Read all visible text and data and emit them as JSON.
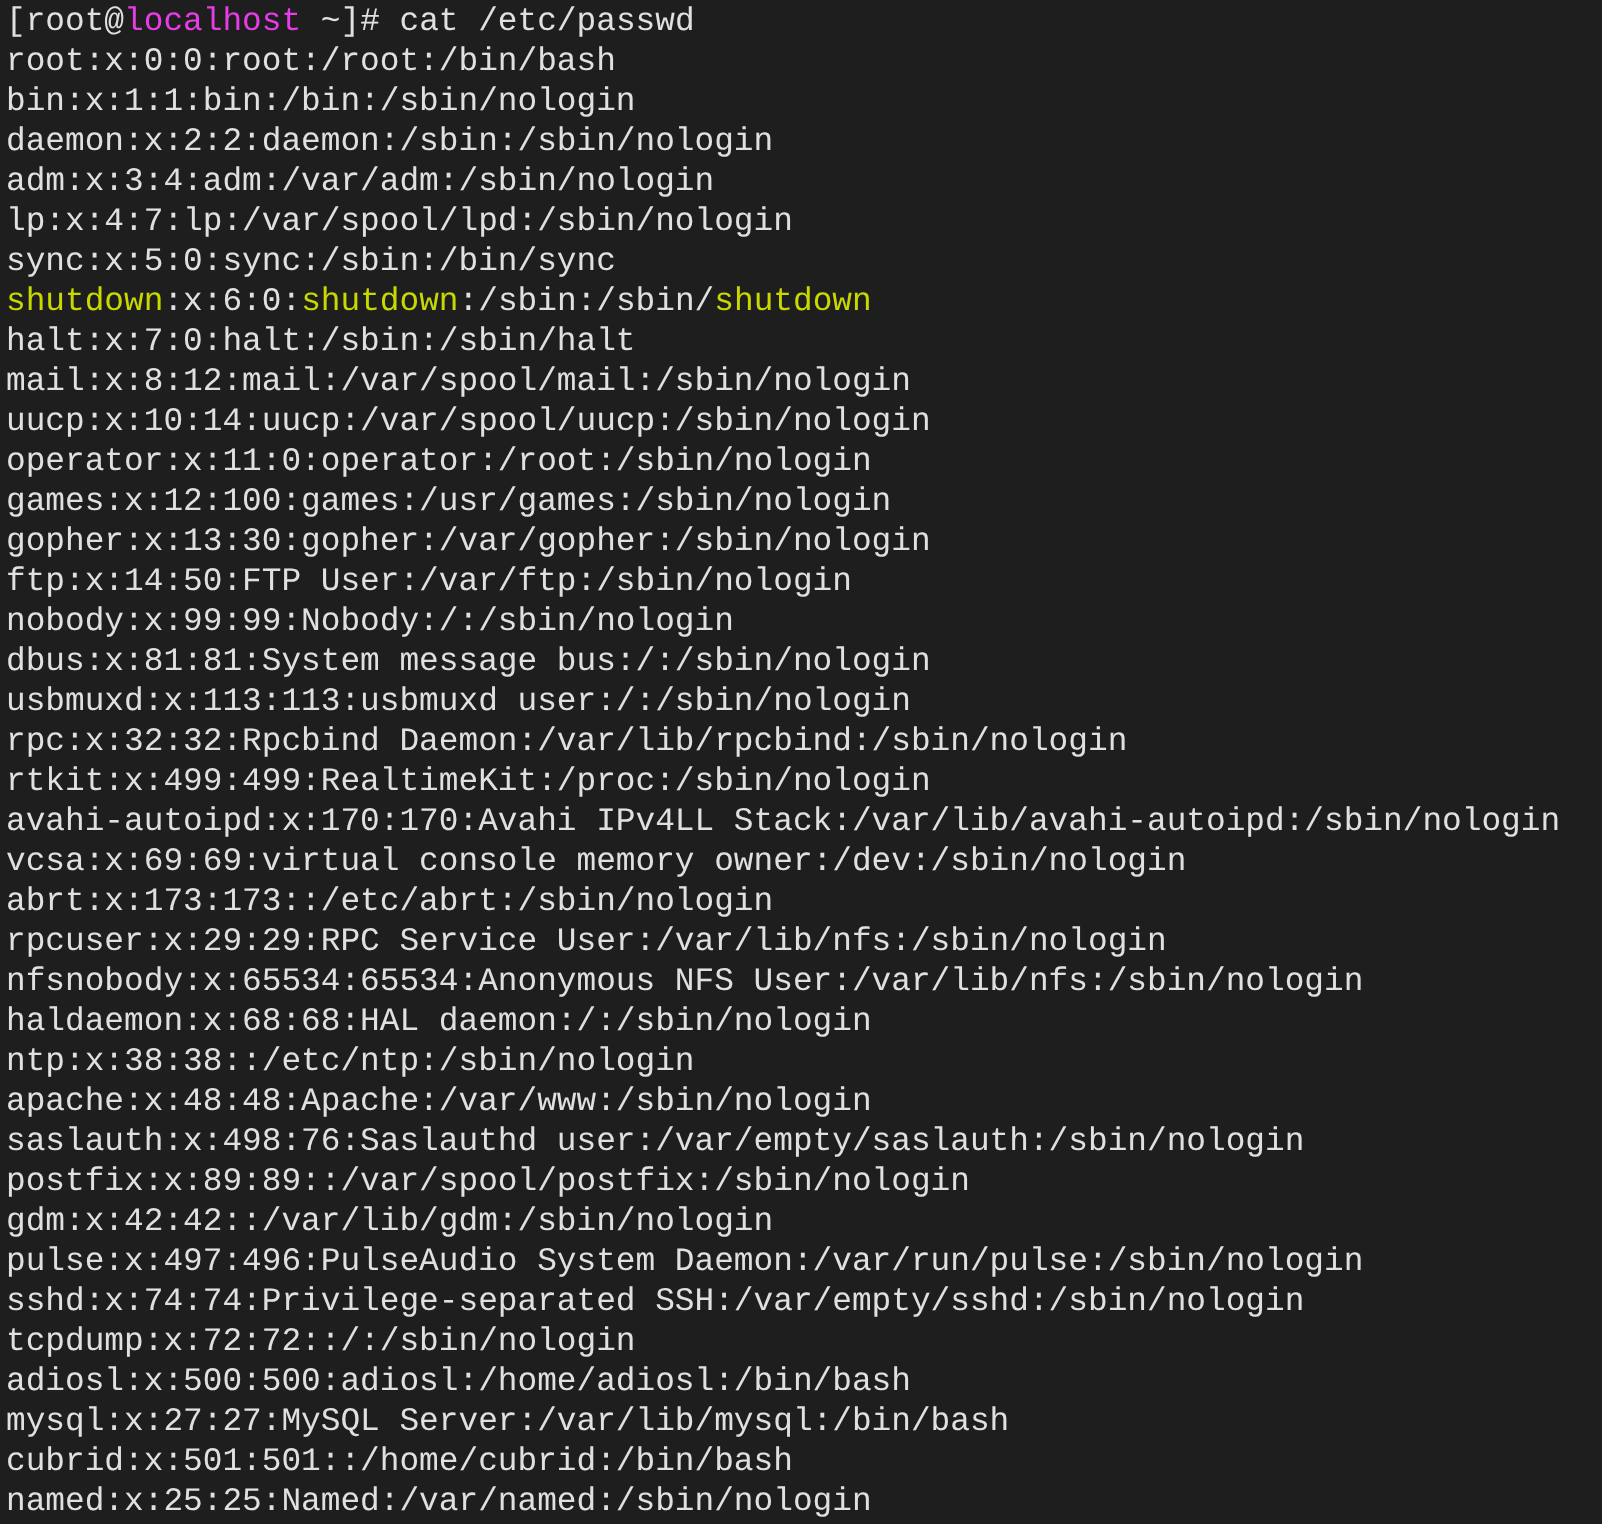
{
  "terminal": {
    "lines": [
      {
        "segments": [
          {
            "text": "[root@",
            "color": "#e0e0e0"
          },
          {
            "text": "localhost",
            "color": "#e83ce8"
          },
          {
            "text": " ~]# cat /etc/passwd",
            "color": "#e0e0e0"
          }
        ]
      },
      {
        "segments": [
          {
            "text": "root:x:0:0:root:/root:/bin/bash",
            "color": "#e0e0e0"
          }
        ]
      },
      {
        "segments": [
          {
            "text": "bin:x:1:1:bin:/bin:/sbin/nologin",
            "color": "#e0e0e0"
          }
        ]
      },
      {
        "segments": [
          {
            "text": "daemon:x:2:2:daemon:/sbin:/sbin/nologin",
            "color": "#e0e0e0"
          }
        ]
      },
      {
        "segments": [
          {
            "text": "adm:x:3:4:adm:/var/adm:/sbin/nologin",
            "color": "#e0e0e0"
          }
        ]
      },
      {
        "segments": [
          {
            "text": "lp:x:4:7:lp:/var/spool/lpd:/sbin/nologin",
            "color": "#e0e0e0"
          }
        ]
      },
      {
        "segments": [
          {
            "text": "sync:x:5:0:sync:/sbin:/bin/sync",
            "color": "#e0e0e0"
          }
        ]
      },
      {
        "segments": [
          {
            "text": "shutdown",
            "color": "#c8d800"
          },
          {
            "text": ":x:6:0:",
            "color": "#e0e0e0"
          },
          {
            "text": "shutdown",
            "color": "#c8d800"
          },
          {
            "text": ":/sbin:/sbin/",
            "color": "#e0e0e0"
          },
          {
            "text": "shutdown",
            "color": "#c8d800"
          }
        ]
      },
      {
        "segments": [
          {
            "text": "halt:x:7:0:halt:/sbin:/sbin/halt",
            "color": "#e0e0e0"
          }
        ]
      },
      {
        "segments": [
          {
            "text": "mail:x:8:12:mail:/var/spool/mail:/sbin/nologin",
            "color": "#e0e0e0"
          }
        ]
      },
      {
        "segments": [
          {
            "text": "uucp:x:10:14:uucp:/var/spool/uucp:/sbin/nologin",
            "color": "#e0e0e0"
          }
        ]
      },
      {
        "segments": [
          {
            "text": "operator:x:11:0:operator:/root:/sbin/nologin",
            "color": "#e0e0e0"
          }
        ]
      },
      {
        "segments": [
          {
            "text": "games:x:12:100:games:/usr/games:/sbin/nologin",
            "color": "#e0e0e0"
          }
        ]
      },
      {
        "segments": [
          {
            "text": "gopher:x:13:30:gopher:/var/gopher:/sbin/nologin",
            "color": "#e0e0e0"
          }
        ]
      },
      {
        "segments": [
          {
            "text": "ftp:x:14:50:FTP User:/var/ftp:/sbin/nologin",
            "color": "#e0e0e0"
          }
        ]
      },
      {
        "segments": [
          {
            "text": "nobody:x:99:99:Nobody:/:/sbin/nologin",
            "color": "#e0e0e0"
          }
        ]
      },
      {
        "segments": [
          {
            "text": "dbus:x:81:81:System message bus:/:/sbin/nologin",
            "color": "#e0e0e0"
          }
        ]
      },
      {
        "segments": [
          {
            "text": "usbmuxd:x:113:113:usbmuxd user:/:/sbin/nologin",
            "color": "#e0e0e0"
          }
        ]
      },
      {
        "segments": [
          {
            "text": "rpc:x:32:32:Rpcbind Daemon:/var/lib/rpcbind:/sbin/nologin",
            "color": "#e0e0e0"
          }
        ]
      },
      {
        "segments": [
          {
            "text": "rtkit:x:499:499:RealtimeKit:/proc:/sbin/nologin",
            "color": "#e0e0e0"
          }
        ]
      },
      {
        "segments": [
          {
            "text": "avahi-autoipd:x:170:170:Avahi IPv4LL Stack:/var/lib/avahi-autoipd:/sbin/nologin",
            "color": "#e0e0e0"
          }
        ]
      },
      {
        "segments": [
          {
            "text": "vcsa:x:69:69:virtual console memory owner:/dev:/sbin/nologin",
            "color": "#e0e0e0"
          }
        ]
      },
      {
        "segments": [
          {
            "text": "abrt:x:173:173::/etc/abrt:/sbin/nologin",
            "color": "#e0e0e0"
          }
        ]
      },
      {
        "segments": [
          {
            "text": "rpcuser:x:29:29:RPC Service User:/var/lib/nfs:/sbin/nologin",
            "color": "#e0e0e0"
          }
        ]
      },
      {
        "segments": [
          {
            "text": "nfsnobody:x:65534:65534:Anonymous NFS User:/var/lib/nfs:/sbin/nologin",
            "color": "#e0e0e0"
          }
        ]
      },
      {
        "segments": [
          {
            "text": "haldaemon:x:68:68:HAL daemon:/:/sbin/nologin",
            "color": "#e0e0e0"
          }
        ]
      },
      {
        "segments": [
          {
            "text": "ntp:x:38:38::/etc/ntp:/sbin/nologin",
            "color": "#e0e0e0"
          }
        ]
      },
      {
        "segments": [
          {
            "text": "apache:x:48:48:Apache:/var/www:/sbin/nologin",
            "color": "#e0e0e0"
          }
        ]
      },
      {
        "segments": [
          {
            "text": "saslauth:x:498:76:Saslauthd user:/var/empty/saslauth:/sbin/nologin",
            "color": "#e0e0e0"
          }
        ]
      },
      {
        "segments": [
          {
            "text": "postfix:x:89:89::/var/spool/postfix:/sbin/nologin",
            "color": "#e0e0e0"
          }
        ]
      },
      {
        "segments": [
          {
            "text": "gdm:x:42:42::/var/lib/gdm:/sbin/nologin",
            "color": "#e0e0e0"
          }
        ]
      },
      {
        "segments": [
          {
            "text": "pulse:x:497:496:PulseAudio System Daemon:/var/run/pulse:/sbin/nologin",
            "color": "#e0e0e0"
          }
        ]
      },
      {
        "segments": [
          {
            "text": "sshd:x:74:74:Privilege-separated SSH:/var/empty/sshd:/sbin/nologin",
            "color": "#e0e0e0"
          }
        ]
      },
      {
        "segments": [
          {
            "text": "tcpdump:x:72:72::/:/sbin/nologin",
            "color": "#e0e0e0"
          }
        ]
      },
      {
        "segments": [
          {
            "text": "adiosl:x:500:500:adiosl:/home/adiosl:/bin/bash",
            "color": "#e0e0e0"
          }
        ]
      },
      {
        "segments": [
          {
            "text": "mysql:x:27:27:MySQL Server:/var/lib/mysql:/bin/bash",
            "color": "#e0e0e0"
          }
        ]
      },
      {
        "segments": [
          {
            "text": "cubrid:x:501:501::/home/cubrid:/bin/bash",
            "color": "#e0e0e0"
          }
        ]
      },
      {
        "segments": [
          {
            "text": "named:x:25:25:Named:/var/named:/sbin/nologin",
            "color": "#e0e0e0"
          }
        ]
      }
    ]
  }
}
